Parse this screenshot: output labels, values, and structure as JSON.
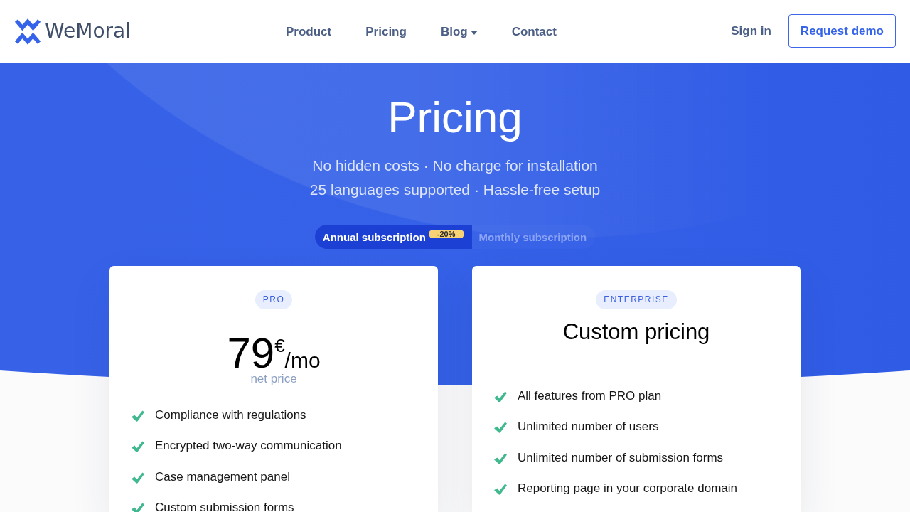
{
  "header": {
    "logo": {
      "text": "WeMoral"
    },
    "nav": [
      {
        "label": "Product",
        "dropdown": false
      },
      {
        "label": "Pricing",
        "dropdown": false
      },
      {
        "label": "Blog",
        "dropdown": true
      },
      {
        "label": "Contact",
        "dropdown": false
      }
    ],
    "sign_in": "Sign in",
    "cta": "Request demo"
  },
  "hero": {
    "title": "Pricing",
    "subtitle_lines": [
      "No hidden costs · No charge for installation",
      "25 languages supported · Hassle-free setup"
    ],
    "billing_toggle": [
      {
        "label": "Annual subscription",
        "badge": "-20%",
        "selected": true
      },
      {
        "label": "Monthly subscription",
        "selected": false
      }
    ]
  },
  "plans": [
    {
      "kind": "price",
      "badge": "PRO",
      "amount": "79",
      "currency": "€",
      "period": "/mo",
      "note": "net price",
      "features": [
        "Compliance with regulations",
        "Encrypted two-way communication",
        "Case management panel",
        "Custom submission forms"
      ]
    },
    {
      "kind": "custom",
      "badge": "ENTERPRISE",
      "title": "Custom pricing",
      "features": [
        "All features from PRO plan",
        "Unlimited number of users",
        "Unlimited number of submission forms",
        "Reporting page in your corporate domain"
      ]
    }
  ]
}
